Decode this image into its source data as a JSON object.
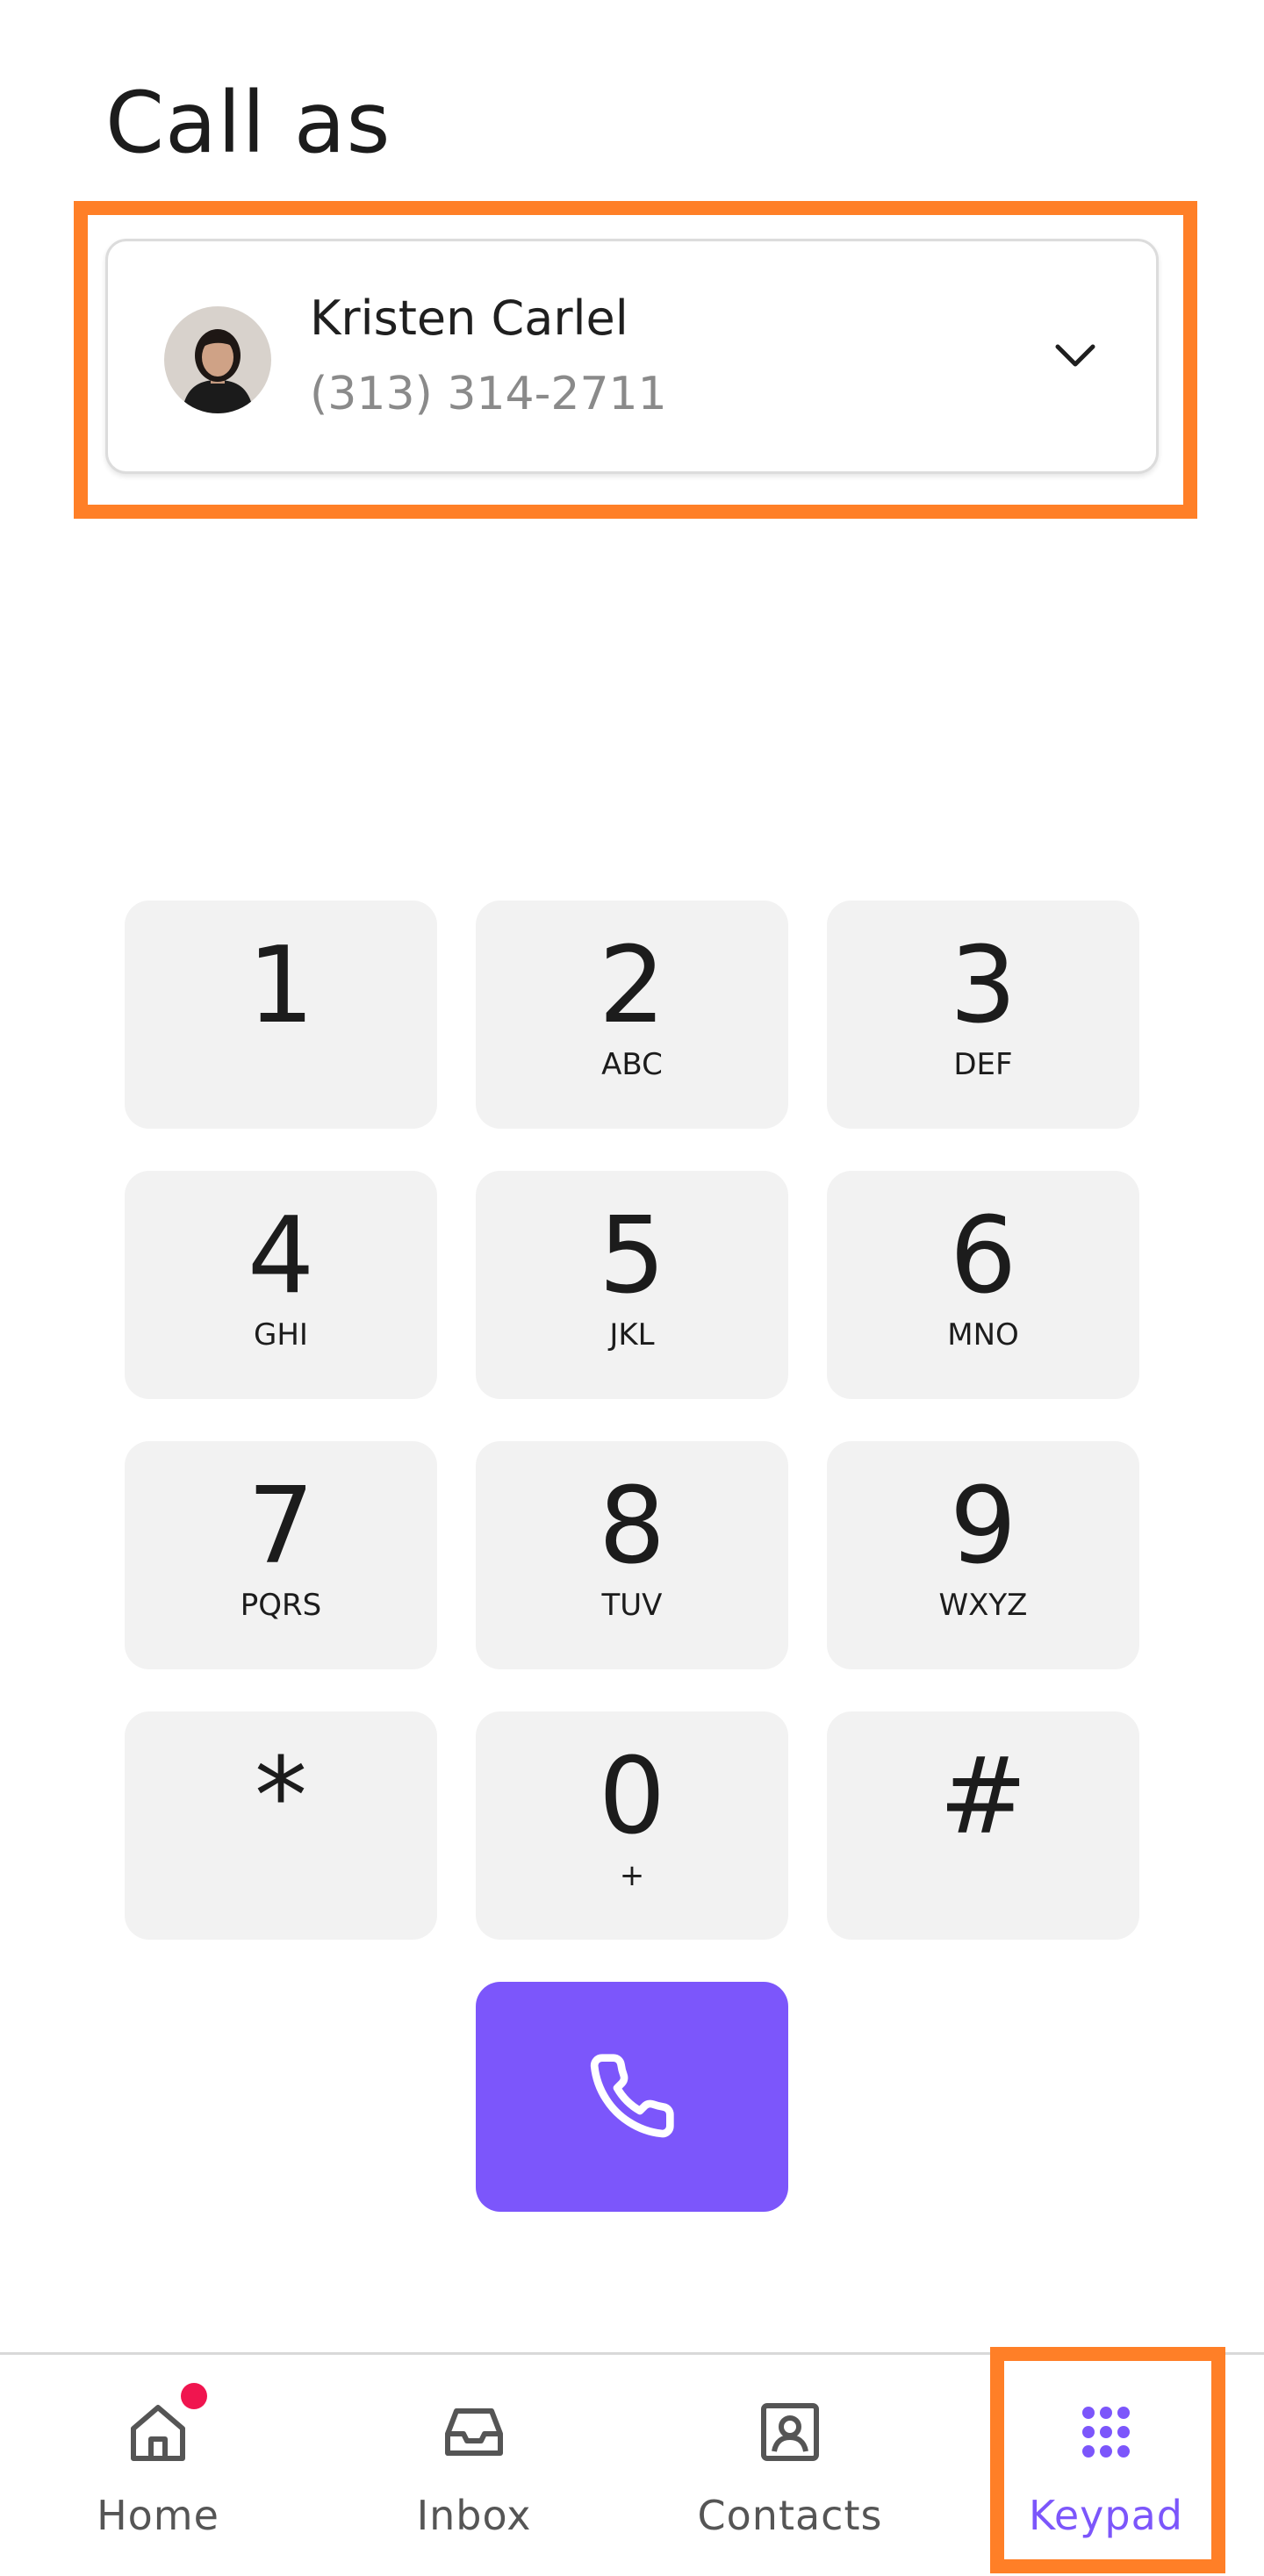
{
  "header": {
    "title": "Call as"
  },
  "caller": {
    "name": "Kristen Carlel",
    "number": "(313) 314-2711"
  },
  "keypad": {
    "keys": [
      {
        "digit": "1",
        "letters": ""
      },
      {
        "digit": "2",
        "letters": "ABC"
      },
      {
        "digit": "3",
        "letters": "DEF"
      },
      {
        "digit": "4",
        "letters": "GHI"
      },
      {
        "digit": "5",
        "letters": "JKL"
      },
      {
        "digit": "6",
        "letters": "MNO"
      },
      {
        "digit": "7",
        "letters": "PQRS"
      },
      {
        "digit": "8",
        "letters": "TUV"
      },
      {
        "digit": "9",
        "letters": "WXYZ"
      },
      {
        "digit": "*",
        "letters": ""
      },
      {
        "digit": "0",
        "letters": "+"
      },
      {
        "digit": "#",
        "letters": ""
      }
    ]
  },
  "nav": {
    "items": [
      {
        "label": "Home",
        "icon": "home-icon",
        "active": false
      },
      {
        "label": "Inbox",
        "icon": "inbox-icon",
        "active": false
      },
      {
        "label": "Contacts",
        "icon": "contacts-icon",
        "active": false
      },
      {
        "label": "Keypad",
        "icon": "keypad-grid-icon",
        "active": true
      }
    ]
  },
  "colors": {
    "accent": "#7c56fb",
    "highlight": "#ff7f27",
    "notification": "#f0154f",
    "key_background": "#f2f2f2"
  }
}
